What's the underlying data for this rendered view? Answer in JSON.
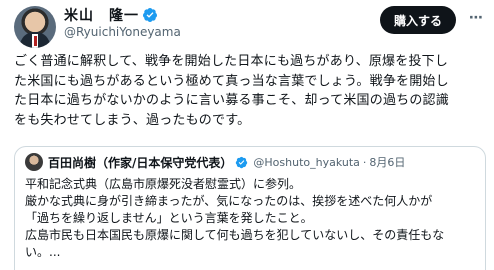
{
  "author": {
    "name": "米山　隆一",
    "handle": "@RyuichiYoneyama",
    "verified_color": "#1d9bf0"
  },
  "actions": {
    "subscribe_label": "購入する",
    "more_label": "⋯"
  },
  "tweet": {
    "lines": [
      "ごく普通に解釈して、戦争を開始した日本にも過ちがあり、原爆を投下し",
      "た米国にも過ちがあるという極めて真っ当な言葉でしょう。戦争を開始し",
      "た日本に過ちがないかのように言い募る事こそ、却って米国の過ちの認識",
      "をも失わせてしまう、過ったものです。"
    ]
  },
  "quote": {
    "name": "百田尚樹（作家/日本保守党代表）",
    "handle": "@Hoshuto_hyakuta",
    "separator": "·",
    "date": "8月6日",
    "lines": [
      "平和記念式典（広島市原爆死没者慰霊式）に参列。",
      "厳かな式典に身が引き締まったが、気になったのは、挨拶を述べた何人かが",
      "「過ちを繰り返しません」という言葉を発したこと。",
      "広島市民も日本国民も原爆に関して何も過ちを犯していないし、その責任もな",
      "い。..."
    ]
  }
}
